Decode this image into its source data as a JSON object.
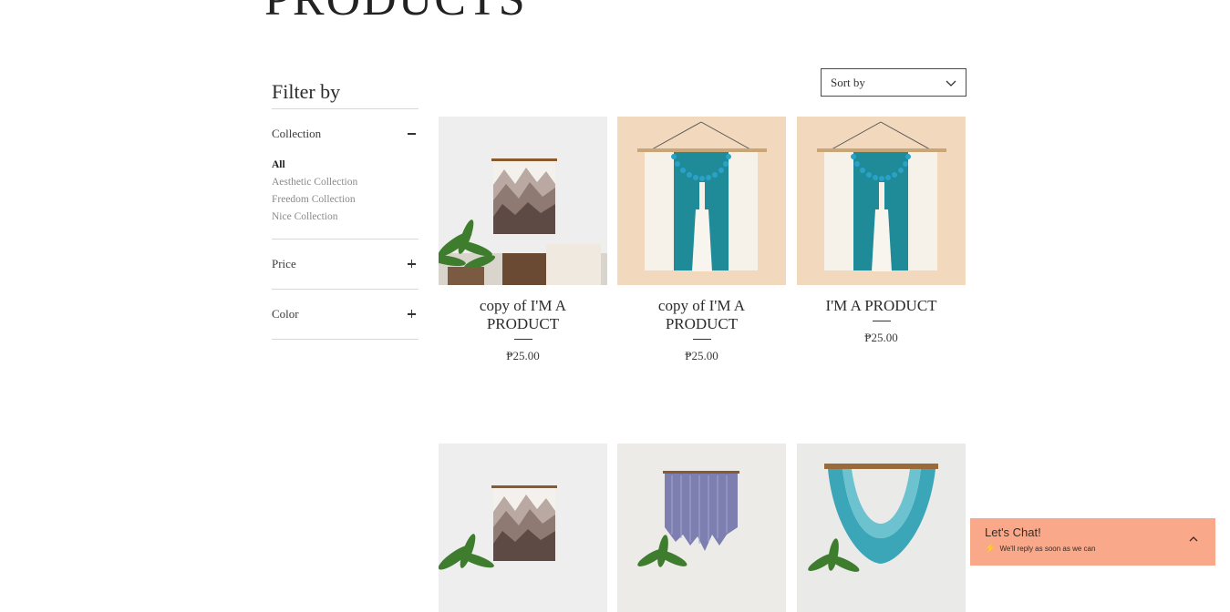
{
  "page": {
    "title": "PRODUCTS"
  },
  "filter": {
    "title": "Filter by",
    "sections": [
      {
        "label": "Collection",
        "state": "collapse-icon"
      },
      {
        "label": "Price",
        "state": "expand-icon"
      },
      {
        "label": "Color",
        "state": "expand-icon"
      }
    ],
    "collection_options": [
      "All",
      "Aesthetic Collection",
      "Freedom Collection",
      "Nice Collection"
    ]
  },
  "sort": {
    "label": "Sort by",
    "icon": "chevron-down-icon"
  },
  "products": [
    {
      "name": "copy of I'M A PRODUCT",
      "price": "₱25.00",
      "image": "mountain-wall-hanging"
    },
    {
      "name": "copy of I'M A PRODUCT",
      "price": "₱25.00",
      "image": "teal-tassel-wall-hanging"
    },
    {
      "name": "I'M A PRODUCT",
      "price": "₱25.00",
      "image": "teal-tassel-wall-hanging"
    },
    {
      "name": "",
      "price": "",
      "image": "mountain-wall-hanging"
    },
    {
      "name": "",
      "price": "",
      "image": "lavender-wall-hanging"
    },
    {
      "name": "",
      "price": "",
      "image": "teal-swoop-wall-hanging"
    }
  ],
  "chat": {
    "title": "Let's Chat!",
    "subtitle": "We'll reply as soon as we can",
    "bolt_icon": "bolt-icon",
    "toggle_icon": "chevron-up-icon",
    "background": "#f9a98a"
  }
}
